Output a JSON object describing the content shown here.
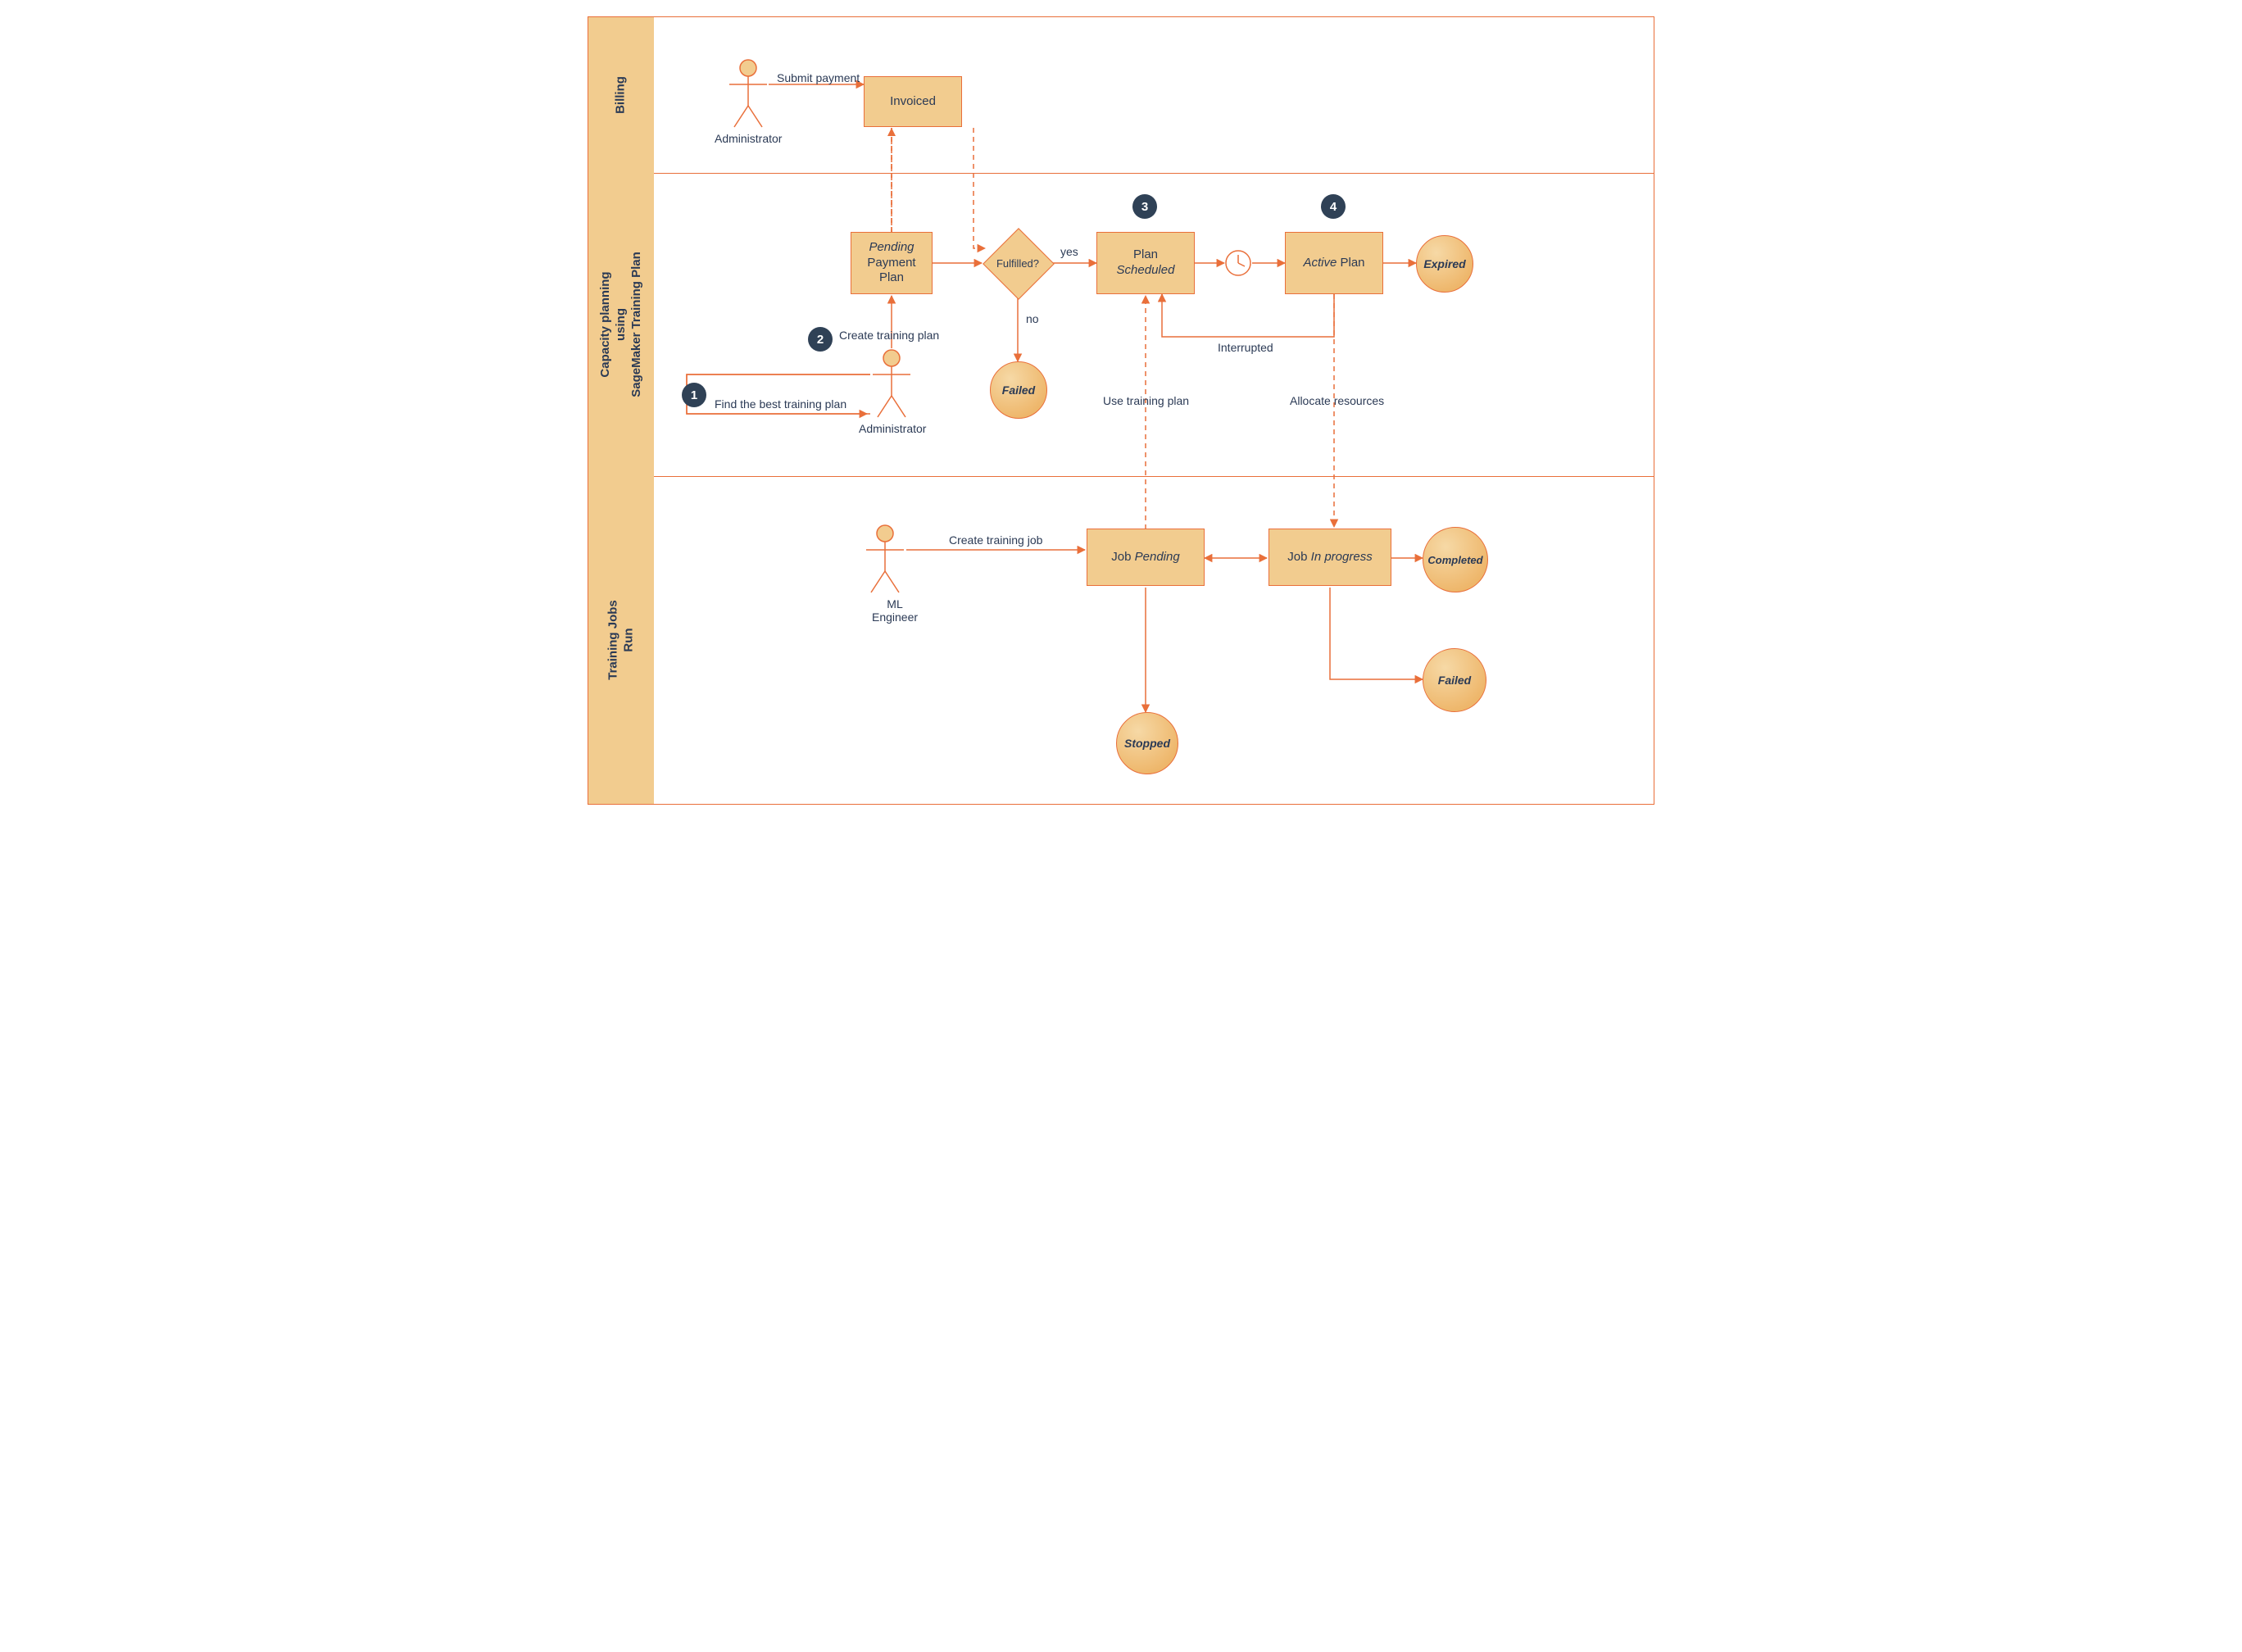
{
  "lanes": {
    "billing": "Billing",
    "capacity": "Capacity planning\nusing\nSageMaker Training Plan",
    "jobs": "Training Jobs\nRun"
  },
  "actors": {
    "admin_billing": "Administrator",
    "admin_capacity": "Administrator",
    "ml_engineer": "ML\nEngineer"
  },
  "billing": {
    "submit_payment": "Submit payment",
    "invoiced": "Invoiced"
  },
  "capacity": {
    "step1": "1",
    "step2": "2",
    "step3": "3",
    "step4": "4",
    "find_best": "Find the best training plan",
    "create_plan": "Create training plan",
    "pending_payment_top": "Pending",
    "pending_payment_rest": "Payment\nPlan",
    "fulfilled_q": "Fulfilled?",
    "yes": "yes",
    "no": "no",
    "failed": "Failed",
    "plan_scheduled_a": "Plan",
    "plan_scheduled_b": "Scheduled",
    "active_a": "Active",
    "active_b": " Plan",
    "expired": "Expired",
    "interrupted": "Interrupted",
    "use_plan": "Use training plan",
    "allocate": "Allocate resources"
  },
  "jobs": {
    "create_job": "Create training job",
    "pending_a": "Job ",
    "pending_b": "Pending",
    "inprog_a": "Job ",
    "inprog_b": "In progress",
    "completed": "Completed",
    "failed": "Failed",
    "stopped": "Stopped"
  }
}
